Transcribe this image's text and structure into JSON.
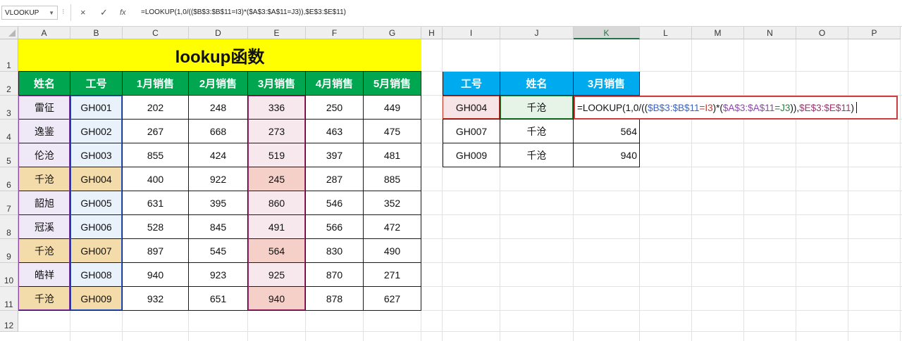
{
  "name_box": "VLOOKUP",
  "formula_bar": "=LOOKUP(1,0/(($B$3:$B$11=I3)*($A$3:$A$11=J3)),$E$3:$E$11)",
  "icons": {
    "cancel": "×",
    "confirm": "✓",
    "function": "fx",
    "separator": "⁝",
    "dropdown": "▼"
  },
  "columns": [
    "A",
    "B",
    "C",
    "D",
    "E",
    "F",
    "G",
    "H",
    "I",
    "J",
    "K",
    "L",
    "M",
    "N",
    "O",
    "P"
  ],
  "rows": [
    "1",
    "2",
    "3",
    "4",
    "5",
    "6",
    "7",
    "8",
    "9",
    "10",
    "11",
    "12"
  ],
  "title": "lookup函数",
  "main_table": {
    "headers": [
      "姓名",
      "工号",
      "1月销售",
      "2月销售",
      "3月销售",
      "4月销售",
      "5月销售"
    ],
    "rows": [
      [
        "雷征",
        "GH001",
        "202",
        "248",
        "336",
        "250",
        "449"
      ],
      [
        "逸鉴",
        "GH002",
        "267",
        "668",
        "273",
        "463",
        "475"
      ],
      [
        "伦沧",
        "GH003",
        "855",
        "424",
        "519",
        "397",
        "481"
      ],
      [
        "千沧",
        "GH004",
        "400",
        "922",
        "245",
        "287",
        "885"
      ],
      [
        "韶旭",
        "GH005",
        "631",
        "395",
        "860",
        "546",
        "352"
      ],
      [
        "冠溪",
        "GH006",
        "528",
        "845",
        "491",
        "566",
        "472"
      ],
      [
        "千沧",
        "GH007",
        "897",
        "545",
        "564",
        "830",
        "490"
      ],
      [
        "皓祥",
        "GH008",
        "940",
        "923",
        "925",
        "870",
        "271"
      ],
      [
        "千沧",
        "GH009",
        "932",
        "651",
        "940",
        "878",
        "627"
      ]
    ]
  },
  "lookup_table": {
    "headers": [
      "工号",
      "姓名",
      "3月销售"
    ],
    "rows": [
      [
        "GH004",
        "千沧",
        "=LOOKUP(1,0/(($B$3:$B$11=I3)*($A$3:$A$11=J3)),$E$3:$E$11)"
      ],
      [
        "GH007",
        "千沧",
        "564"
      ],
      [
        "GH009",
        "千沧",
        "940"
      ]
    ]
  },
  "edit_formula_parts": [
    {
      "text": "=LOOKUP(1,0/",
      "color": "#111111"
    },
    {
      "text": "((",
      "color": "#111111"
    },
    {
      "text": "$B$3:$B$11",
      "color": "#3b63c4"
    },
    {
      "text": "=I3",
      "color": "#c0392b"
    },
    {
      "text": ")*(",
      "color": "#111111"
    },
    {
      "text": "$A$3:$A$11",
      "color": "#8e44ad"
    },
    {
      "text": "=J3",
      "color": "#27823a"
    },
    {
      "text": ")),",
      "color": "#111111"
    },
    {
      "text": "$E$3:$E$11",
      "color": "#a0306e"
    },
    {
      "text": ")",
      "color": "#111111"
    }
  ],
  "colors": {
    "title_bg": "#ffff00",
    "header_green": "#00a650",
    "header_blue": "#00aaee",
    "name_col": "#efe9f7",
    "id_col": "#e9f1fa",
    "march_col": "#f7e8ee",
    "match_row_name": "#f3dcaa",
    "match_row_id": "#f3dcaa",
    "match_row_march": "#f5d0c8"
  }
}
